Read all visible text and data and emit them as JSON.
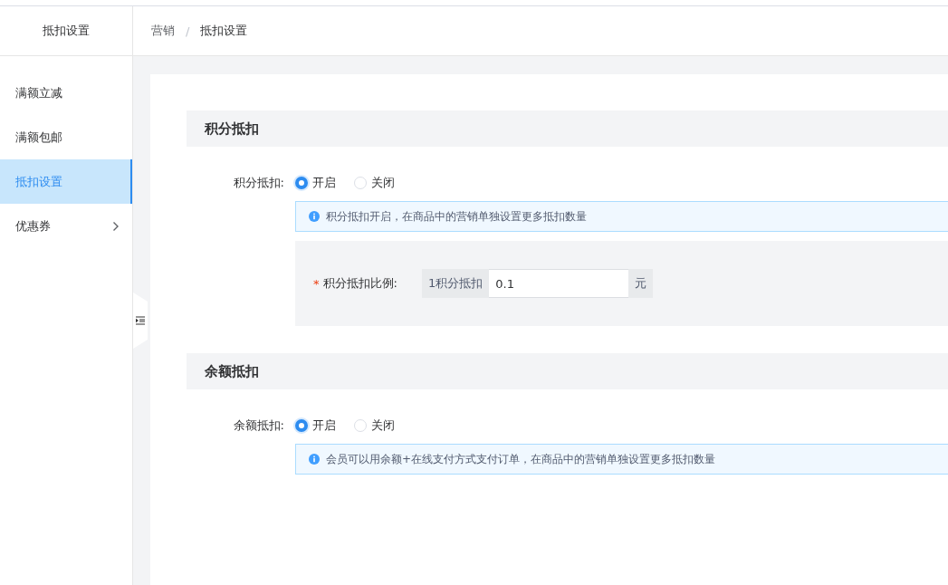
{
  "sidebar": {
    "title": "抵扣设置",
    "items": [
      {
        "label": "满额立减",
        "selected": false,
        "has_children": false
      },
      {
        "label": "满额包邮",
        "selected": false,
        "has_children": false
      },
      {
        "label": "抵扣设置",
        "selected": true,
        "has_children": false
      },
      {
        "label": "优惠券",
        "selected": false,
        "has_children": true
      }
    ]
  },
  "breadcrumb": [
    "营销",
    "抵扣设置"
  ],
  "breadcrumb_separator": "/",
  "sections": [
    {
      "title": "积分抵扣",
      "field_label": "积分抵扣:",
      "options": [
        {
          "label": "开启",
          "selected": true
        },
        {
          "label": "关闭",
          "selected": false
        }
      ],
      "info": "积分抵扣开启，在商品中的营销单独设置更多抵扣数量",
      "ratio": {
        "label": "积分抵扣比例:",
        "required_mark": "*",
        "prefix": "1积分抵扣",
        "value": "0.1",
        "suffix": "元"
      }
    },
    {
      "title": "余额抵扣",
      "field_label": "余额抵扣:",
      "options": [
        {
          "label": "开启",
          "selected": true
        },
        {
          "label": "关闭",
          "selected": false
        }
      ],
      "info": "会员可以用余额+在线支付方式支付订单，在商品中的营销单独设置更多抵扣数量"
    }
  ]
}
